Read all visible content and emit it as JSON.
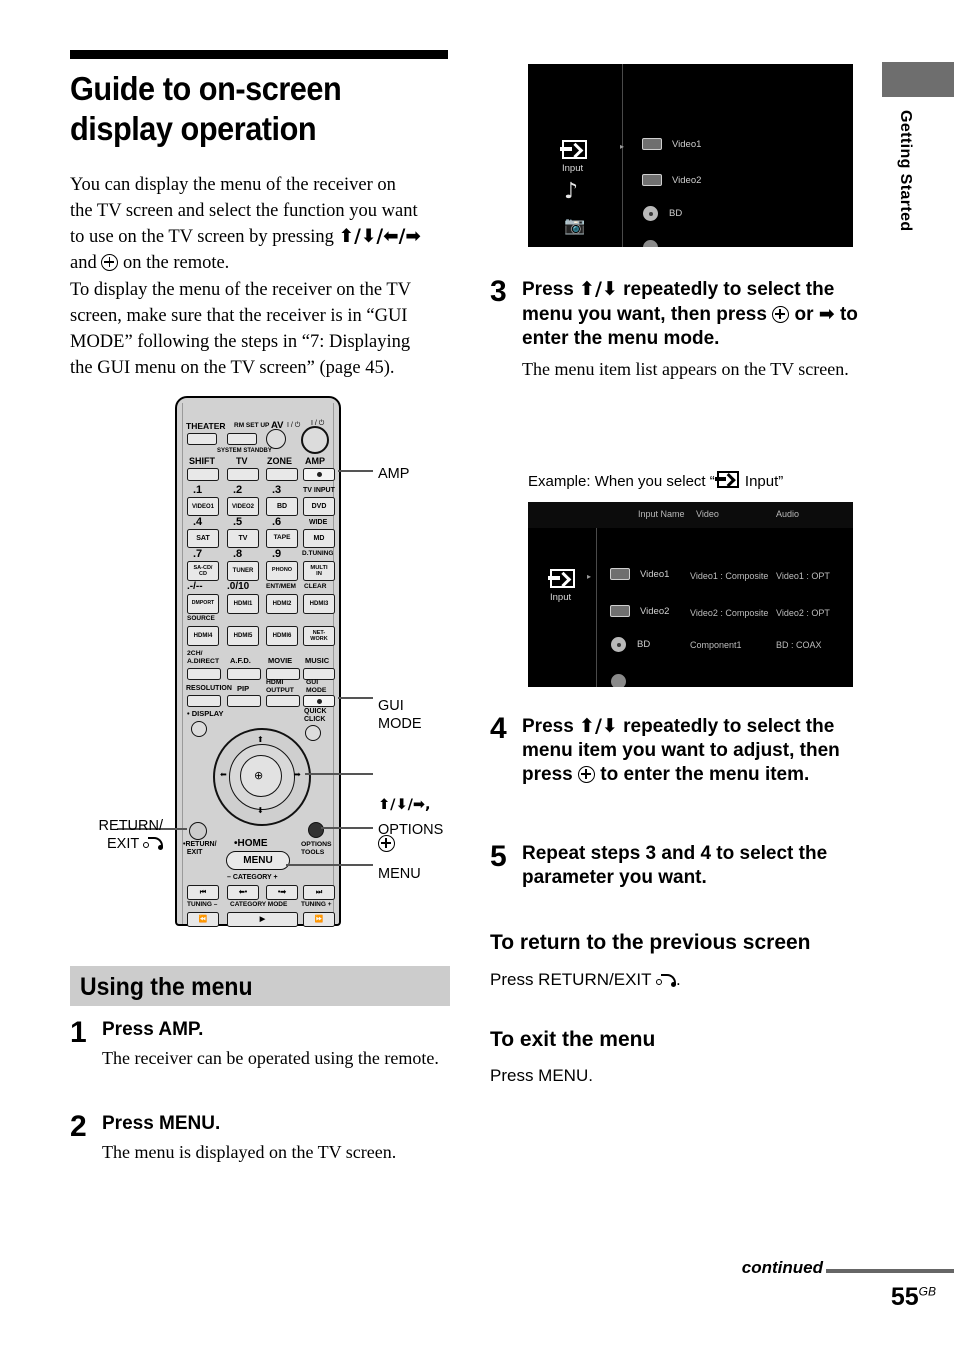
{
  "page": {
    "title": "Guide to on-screen display operation",
    "intro": "You can display the menu of the receiver on the TV screen and select the function you want to use on the TV screen by pressing ⬆/⬇/⬅/➡ and ⨁ on the remote.\nTo display the menu of the receiver on the TV screen, make sure that the receiver is in “GUI MODE” following the steps in “7: Displaying the GUI menu on the TV screen” (page 45).",
    "intro_line1": "You can display the menu of the receiver on",
    "intro_line2": "the TV screen and select the function you want",
    "intro_line3a": "to use on the TV screen by pressing ",
    "intro_line3b": "♦/♦/♦/♦",
    "intro_line4a": "and ",
    "intro_line4b": " on the remote.",
    "intro_line5": "To display the menu of the receiver on the TV",
    "intro_line6": "screen, make sure that the receiver is in “GUI",
    "intro_line7": "MODE” following the steps in “7: Displaying",
    "intro_line8": "the GUI menu on the TV screen” (page 45)."
  },
  "sidebar_tab": {
    "label": "Getting Started",
    "block_color": "#6e6e6e"
  },
  "remote": {
    "top_labels": {
      "theater": "THEATER",
      "rm_set_up": "RM SET UP",
      "av": "AV",
      "av_power": "I / ⏻",
      "main_power": "I / ⏻",
      "system_standby": "SYSTEM STANDBY"
    },
    "mode_row": [
      "SHIFT",
      "TV",
      "ZONE",
      "AMP"
    ],
    "numeric_rows": [
      {
        "nums": [
          ".1",
          ".2",
          ".3",
          "TV INPUT"
        ],
        "keys": [
          "VIDEO1",
          "VIDEO2",
          "BD",
          "DVD"
        ]
      },
      {
        "nums": [
          ".4",
          ".5",
          ".6",
          "WIDE"
        ],
        "keys": [
          "SAT",
          "TV",
          "TAPE",
          "MD"
        ]
      },
      {
        "nums": [
          ".7",
          ".8",
          ".9",
          "D.TUNING"
        ],
        "keys": [
          "SA-CD/\nCD",
          "TUNER",
          "PHONO",
          "MULTI\nIN"
        ]
      },
      {
        "nums": [
          ".-/--",
          ".0/10",
          "ENT/MEM",
          "CLEAR"
        ],
        "keys": [
          "DMPORT",
          "HDMI1",
          "HDMI2",
          "HDMI3"
        ]
      },
      {
        "nums": [
          "SOURCE",
          "",
          "",
          ""
        ],
        "keys": [
          "HDMI4",
          "HDMI5",
          "HDMI6",
          "NET-\nWORK"
        ]
      }
    ],
    "sound_row": [
      "2CH/\nA.DIRECT",
      "A.F.D.",
      "MOVIE",
      "MUSIC"
    ],
    "func_row": [
      "RESOLUTION",
      "PIP",
      "HDMI\nOUTPUT",
      "GUI\nMODE"
    ],
    "display_label": "DISPLAY",
    "quick_click_label": "QUICK\nCLICK",
    "home_label": "HOME",
    "menu_label": "MENU",
    "return_label": "RETURN/\nEXIT",
    "options_label": "OPTIONS\nTOOLS",
    "category_label": "– CATEGORY +",
    "transport_keys": [
      "⏮◂◂",
      "◂•",
      "•▸",
      "▸▸⏭"
    ],
    "bottom_labels": [
      "TUNING –",
      "CATEGORY MODE",
      "TUNING +"
    ]
  },
  "callouts": {
    "amp": "AMP",
    "gui_mode": "GUI\nMODE",
    "nav": "♦/♦/♦,",
    "options": "OPTIONS",
    "menu": "MENU",
    "return_exit": "RETURN/\nEXIT"
  },
  "using_the_menu": {
    "heading": "Using the menu",
    "steps": [
      {
        "num": "1",
        "head": "Press AMP.",
        "sub": "The receiver can be operated using the remote."
      },
      {
        "num": "2",
        "head": "Press MENU.",
        "sub": "The menu is displayed on the TV screen."
      }
    ]
  },
  "right_steps": [
    {
      "num": "3",
      "head_a": "Press ♦/♦ repeatedly to select the menu you want, then press ",
      "head_b": " or ➡ to enter the menu mode.",
      "sub": "The menu item list appears on the TV screen."
    },
    {
      "num": "4",
      "head_a": "Press ♦/♦ repeatedly to select the menu item you want to adjust, then press ",
      "head_b": " to enter the menu item.",
      "sub": ""
    },
    {
      "num": "5",
      "head_a": "Repeat steps 3 and 4 to select the parameter you want.",
      "head_b": "",
      "sub": ""
    }
  ],
  "example_caption": {
    "prefix": "Example: When you select “",
    "suffix": " Input”"
  },
  "tv_screen_1": {
    "side_items": [
      "input-icon",
      "music-note-icon",
      "camera-icon"
    ],
    "side_label": "Input",
    "rows": [
      {
        "label": "Video1",
        "icon": "video-deck-icon"
      },
      {
        "label": "Video2",
        "icon": "video-deck-icon"
      },
      {
        "label": "BD",
        "icon": "disc-icon"
      }
    ]
  },
  "tv_screen_2": {
    "columns": [
      "Input Name",
      "Video",
      "Audio"
    ],
    "side_label": "Input",
    "rows": [
      {
        "name": "Video1",
        "video": "Video1 : Composite",
        "audio": "Video1 : OPT",
        "icon": "video-deck-icon"
      },
      {
        "name": "Video2",
        "video": "Video2 : Composite",
        "audio": "Video2 : OPT",
        "icon": "video-deck-icon"
      },
      {
        "name": "BD",
        "video": "Component1",
        "audio": "BD : COAX",
        "icon": "disc-icon"
      }
    ]
  },
  "sections": [
    {
      "heading": "To return to the previous screen",
      "body_prefix": "Press RETURN/EXIT ",
      "body_suffix": "."
    },
    {
      "heading": "To exit the menu",
      "body_prefix": "Press MENU.",
      "body_suffix": ""
    }
  ],
  "footer": {
    "continued": "continued",
    "page_number": "55",
    "page_suffix": "GB"
  }
}
